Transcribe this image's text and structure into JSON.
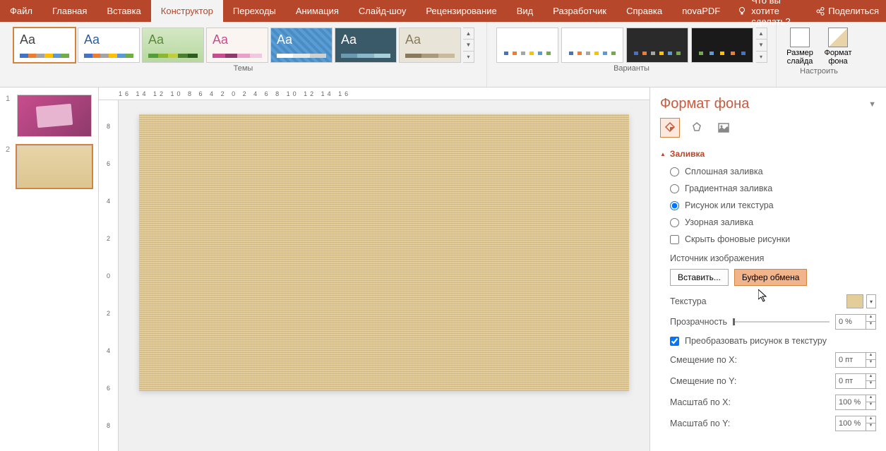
{
  "tabs": {
    "file": "Файл",
    "home": "Главная",
    "insert": "Вставка",
    "design": "Конструктор",
    "transitions": "Переходы",
    "animations": "Анимация",
    "slideshow": "Слайд-шоу",
    "review": "Рецензирование",
    "view": "Вид",
    "developer": "Разработчик",
    "help": "Справка",
    "novapdf": "novaPDF",
    "tellme": "Что вы хотите сделать?",
    "share": "Поделиться"
  },
  "ribbon": {
    "themes_label": "Темы",
    "variants_label": "Варианты",
    "customize_label": "Настроить",
    "slide_size": "Размер слайда",
    "format_bg": "Формат фона"
  },
  "slides": {
    "n1": "1",
    "n2": "2"
  },
  "ruler_h": "16   14   12   10   8   6   4   2   0   2   4   6   8   10   12   14   16",
  "ruler_v": [
    "8",
    "6",
    "4",
    "2",
    "0",
    "2",
    "4",
    "6",
    "8"
  ],
  "pane": {
    "title": "Формат фона",
    "section_fill": "Заливка",
    "fill": {
      "solid": "Сплошная заливка",
      "gradient": "Градиентная заливка",
      "picture": "Рисунок или текстура",
      "pattern": "Узорная заливка",
      "hide_bg": "Скрыть фоновые рисунки"
    },
    "img_source": "Источник изображения",
    "insert_btn": "Вставить...",
    "clipboard_btn": "Буфер обмена",
    "texture": "Текстура",
    "transparency": "Прозрачность",
    "transparency_val": "0 %",
    "tile_as_texture": "Преобразовать рисунок в текстуру",
    "offset_x": "Смещение по X:",
    "offset_x_val": "0 пт",
    "offset_y": "Смещение по Y:",
    "offset_y_val": "0 пт",
    "scale_x": "Масштаб по X:",
    "scale_x_val": "100 %",
    "scale_y": "Масштаб по Y:",
    "scale_y_val": "100 %"
  }
}
